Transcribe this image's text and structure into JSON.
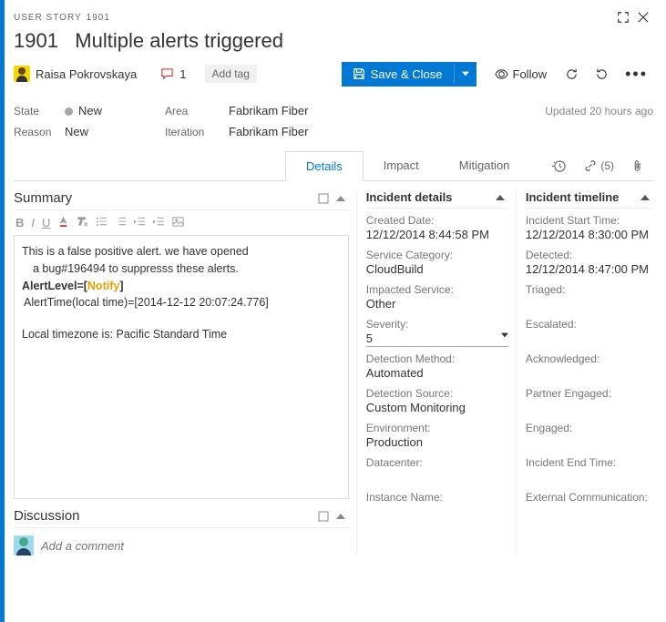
{
  "type": "USER STORY",
  "id_hdr": "1901",
  "id_title": "1901",
  "title": "Multiple alerts triggered",
  "assignee": "Raisa Pokrovskaya",
  "comments": "1",
  "add_tag": "Add tag",
  "save": "Save & Close",
  "follow": "Follow",
  "state": {
    "label": "State",
    "value": "New"
  },
  "reason": {
    "label": "Reason",
    "value": "New"
  },
  "area": {
    "label": "Area",
    "value": "Fabrikam Fiber"
  },
  "iteration": {
    "label": "Iteration",
    "value": "Fabrikam Fiber"
  },
  "updated": "Updated 20 hours ago",
  "tabs": {
    "details": "Details",
    "impact": "Impact",
    "mitigation": "Mitigation",
    "links": "(5)"
  },
  "summary": {
    "hdr": "Summary",
    "line1": "This is a false positive alert. we have opened",
    "line2": "a bug#196494 to suppresss these alerts.",
    "alertlevel_lbl": "AlertLevel=[",
    "alertlevel_val": "Notify",
    "alertlevel_end": "]",
    "alerttime": "AlertTime(local time)=[2014-12-12 20:07:24.776]",
    "tz": "Local timezone is: Pacific Standard Time"
  },
  "discussion": {
    "hdr": "Discussion",
    "placeholder": "Add a comment"
  },
  "incident": {
    "hdr": "Incident details",
    "created_l": "Created Date:",
    "created_v": "12/12/2014 8:44:58 PM",
    "svc_l": "Service Category:",
    "svc_v": "CloudBuild",
    "isvc_l": "Impacted Service:",
    "isvc_v": "Other",
    "sev_l": "Severity:",
    "sev_v": "5",
    "dm_l": "Detection Method:",
    "dm_v": "Automated",
    "ds_l": "Detection Source:",
    "ds_v": "Custom Monitoring",
    "env_l": "Environment:",
    "env_v": "Production",
    "dc_l": "Datacenter:",
    "dc_v": "",
    "in_l": "Instance Name:",
    "in_v": ""
  },
  "timeline": {
    "hdr": "Incident timeline",
    "ist_l": "Incident Start Time:",
    "ist_v": "12/12/2014 8:30:00 PM",
    "det_l": "Detected:",
    "det_v": "12/12/2014 8:47:00 PM",
    "tri_l": "Triaged:",
    "tri_v": "",
    "esc_l": "Escalated:",
    "esc_v": "",
    "ack_l": "Acknowledged:",
    "ack_v": "",
    "pe_l": "Partner Engaged:",
    "pe_v": "",
    "eng_l": "Engaged:",
    "eng_v": "",
    "iet_l": "Incident End Time:",
    "iet_v": "",
    "ec_l": "External Communication:",
    "ec_v": ""
  }
}
